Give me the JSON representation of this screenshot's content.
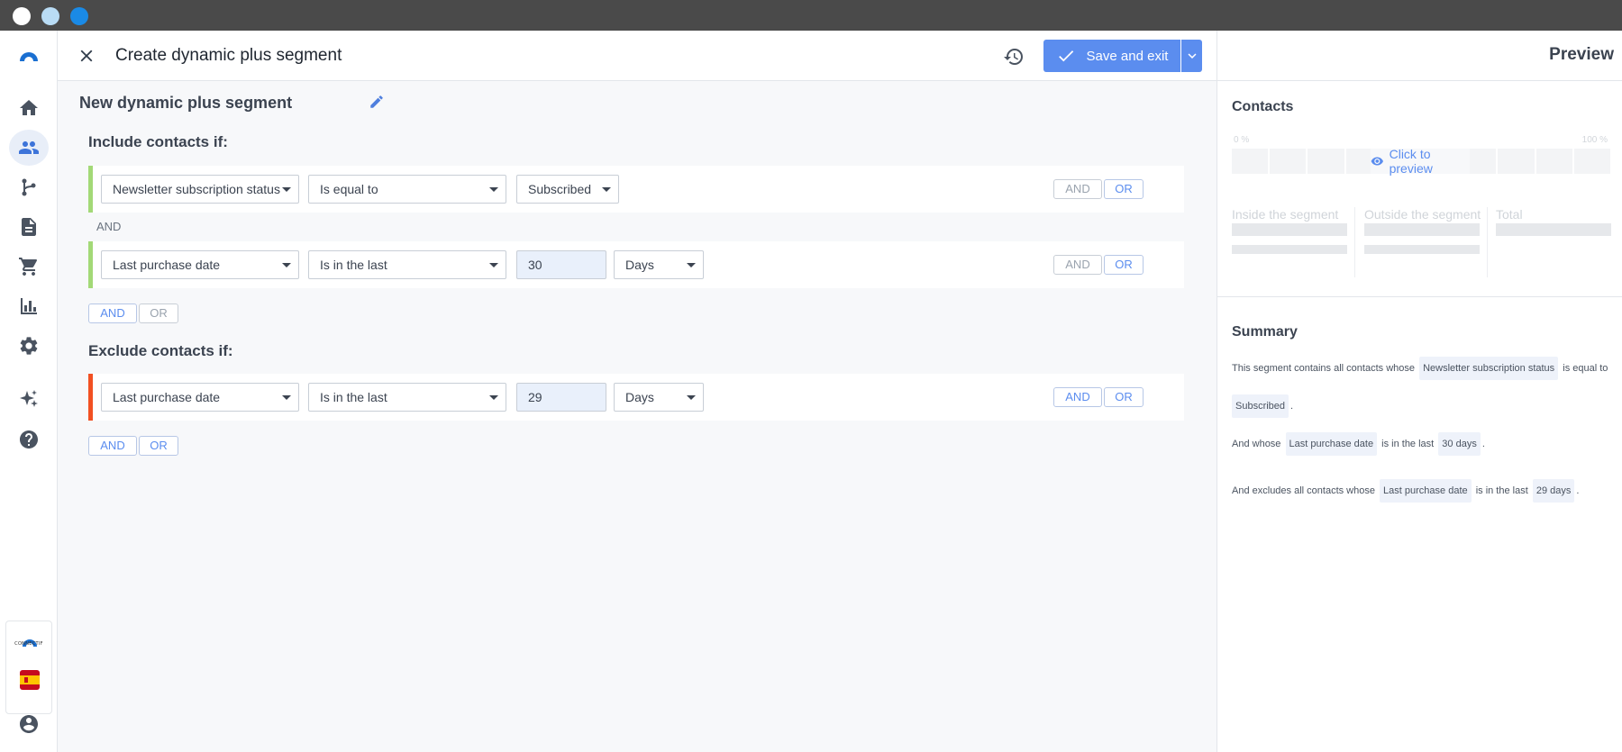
{
  "window": {
    "controls": [
      "close",
      "minimize",
      "maximize"
    ],
    "dot_colors": [
      "#ffffff",
      "#b9dcf5",
      "#1a8ae6"
    ]
  },
  "sidebar": {
    "items": [
      {
        "icon": "logo-icon"
      },
      {
        "icon": "home-icon"
      },
      {
        "icon": "contacts-icon",
        "active": true
      },
      {
        "icon": "flow-icon"
      },
      {
        "icon": "document-icon"
      },
      {
        "icon": "cart-icon"
      },
      {
        "icon": "chart-icon"
      },
      {
        "icon": "gear-icon"
      },
      {
        "icon": "sparkle-icon"
      },
      {
        "icon": "help-icon"
      },
      {
        "icon": "account-icon"
      }
    ],
    "brand_label": "CONNECTIF"
  },
  "header": {
    "title": "Create dynamic plus segment",
    "save_label": "Save and exit"
  },
  "segment": {
    "name": "New dynamic plus segment"
  },
  "include": {
    "title": "Include contacts if:",
    "and_separator": "AND",
    "rules": [
      {
        "field": "Newsletter subscription status",
        "operator": "Is equal to",
        "value": "Subscribed"
      },
      {
        "field": "Last purchase date",
        "operator": "Is in the last",
        "value": "30",
        "unit": "Days"
      }
    ]
  },
  "exclude": {
    "title": "Exclude contacts if:",
    "rules": [
      {
        "field": "Last purchase date",
        "operator": "Is in the last",
        "value": "29",
        "unit": "Days"
      }
    ]
  },
  "logic": {
    "and": "AND",
    "or": "OR"
  },
  "colors": {
    "accent": "#5b8def",
    "include_bar": "#a3d977",
    "exclude_bar": "#f25022"
  },
  "preview": {
    "title": "Preview",
    "contacts_title": "Contacts",
    "pct_low": "0 %",
    "pct_high": "100 %",
    "click_label": "Click to preview",
    "inside_label": "Inside the segment",
    "outside_label": "Outside the segment",
    "total_label": "Total"
  },
  "summary": {
    "title": "Summary",
    "line1_prefix": "This segment contains all contacts whose",
    "line1_chip": "Newsletter subscription status",
    "line1_mid": "is equal to",
    "line2_chip": "Subscribed",
    "line2_end": ".",
    "line3_prefix": "And whose",
    "line3_chip": "Last purchase date",
    "line3_mid": "is in the last",
    "line3_chip2": "30 days",
    "line3_end": ".",
    "line4_prefix": "And excludes all contacts whose",
    "line4_chip": "Last purchase date",
    "line4_mid": "is in the last",
    "line4_chip2": "29 days",
    "line4_end": "."
  }
}
